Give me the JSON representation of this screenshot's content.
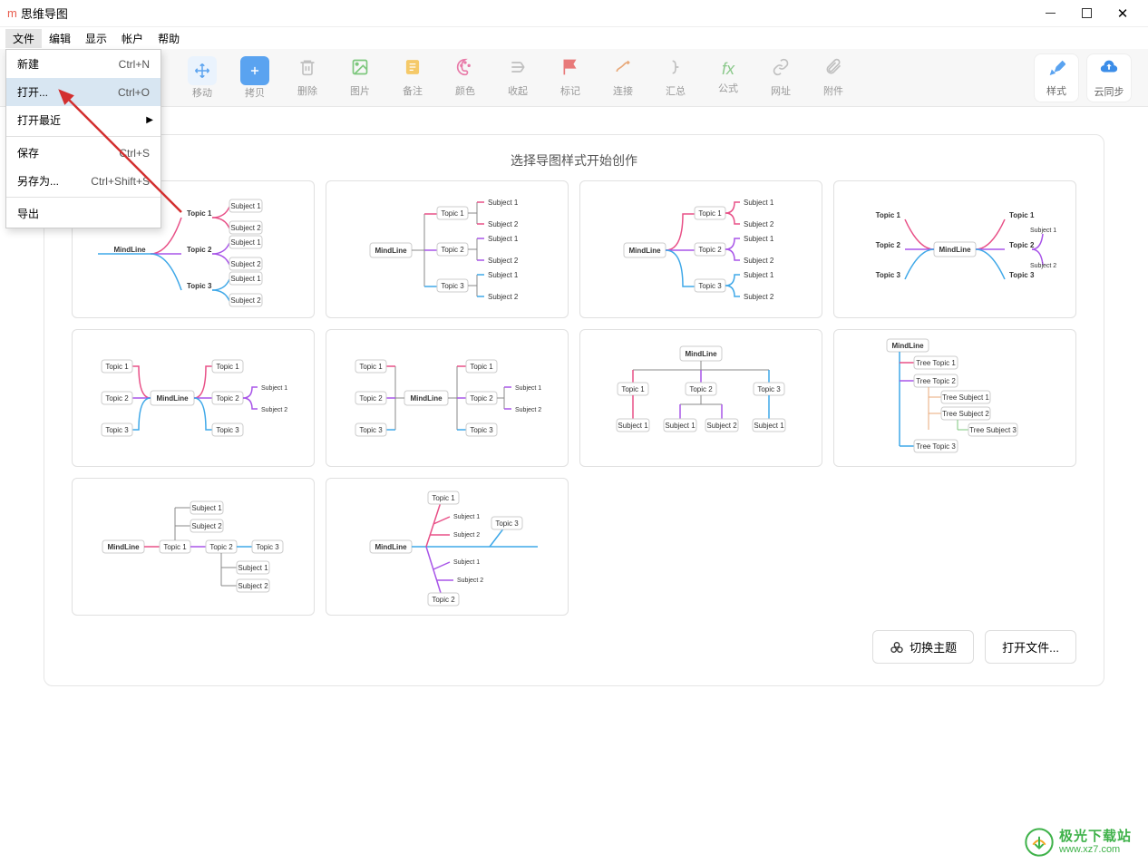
{
  "window": {
    "title": "思维导图",
    "logo_text": "m"
  },
  "menubar": {
    "items": [
      "文件",
      "编辑",
      "显示",
      "帐户",
      "帮助"
    ]
  },
  "dropdown": {
    "items": [
      {
        "label": "新建",
        "shortcut": "Ctrl+N",
        "highlight": false
      },
      {
        "label": "打开...",
        "shortcut": "Ctrl+O",
        "highlight": true
      },
      {
        "label": "打开最近",
        "shortcut": "",
        "submenu": true,
        "highlight": false
      }
    ],
    "sep1": true,
    "items2": [
      {
        "label": "保存",
        "shortcut": "Ctrl+S",
        "highlight": false
      },
      {
        "label": "另存为...",
        "shortcut": "Ctrl+Shift+S",
        "highlight": false
      }
    ],
    "sep2": true,
    "items3": [
      {
        "label": "导出",
        "shortcut": "",
        "highlight": false
      }
    ]
  },
  "toolbar": {
    "main": [
      {
        "name": "move",
        "label": "移动"
      },
      {
        "name": "copy",
        "label": "拷贝"
      },
      {
        "name": "delete",
        "label": "删除"
      },
      {
        "name": "image",
        "label": "图片"
      },
      {
        "name": "note",
        "label": "备注"
      },
      {
        "name": "color",
        "label": "颜色"
      },
      {
        "name": "collapse",
        "label": "收起"
      },
      {
        "name": "mark",
        "label": "标记"
      },
      {
        "name": "connect",
        "label": "连接"
      },
      {
        "name": "summary",
        "label": "汇总"
      },
      {
        "name": "formula",
        "label": "公式"
      },
      {
        "name": "url",
        "label": "网址"
      },
      {
        "name": "attach",
        "label": "附件"
      }
    ],
    "right": [
      {
        "name": "style",
        "label": "样式"
      },
      {
        "name": "cloud",
        "label": "云同步"
      }
    ]
  },
  "panel": {
    "title": "选择导图样式开始创作",
    "footer": {
      "theme": "切换主题",
      "open": "打开文件..."
    },
    "node_labels": {
      "root": "MindLine",
      "topic1": "Topic 1",
      "topic2": "Topic 2",
      "topic3": "Topic 3",
      "subject1": "Subject 1",
      "subject2": "Subject 2",
      "tree1": "Tree Topic 1",
      "tree2": "Tree Topic 2",
      "tree3": "Tree Topic 3",
      "treesub1": "Tree Subject 1",
      "treesub2": "Tree Subject 2",
      "treesub3": "Tree Subject 3"
    }
  },
  "watermark": {
    "main": "极光下载站",
    "sub": "www.xz7.com"
  }
}
